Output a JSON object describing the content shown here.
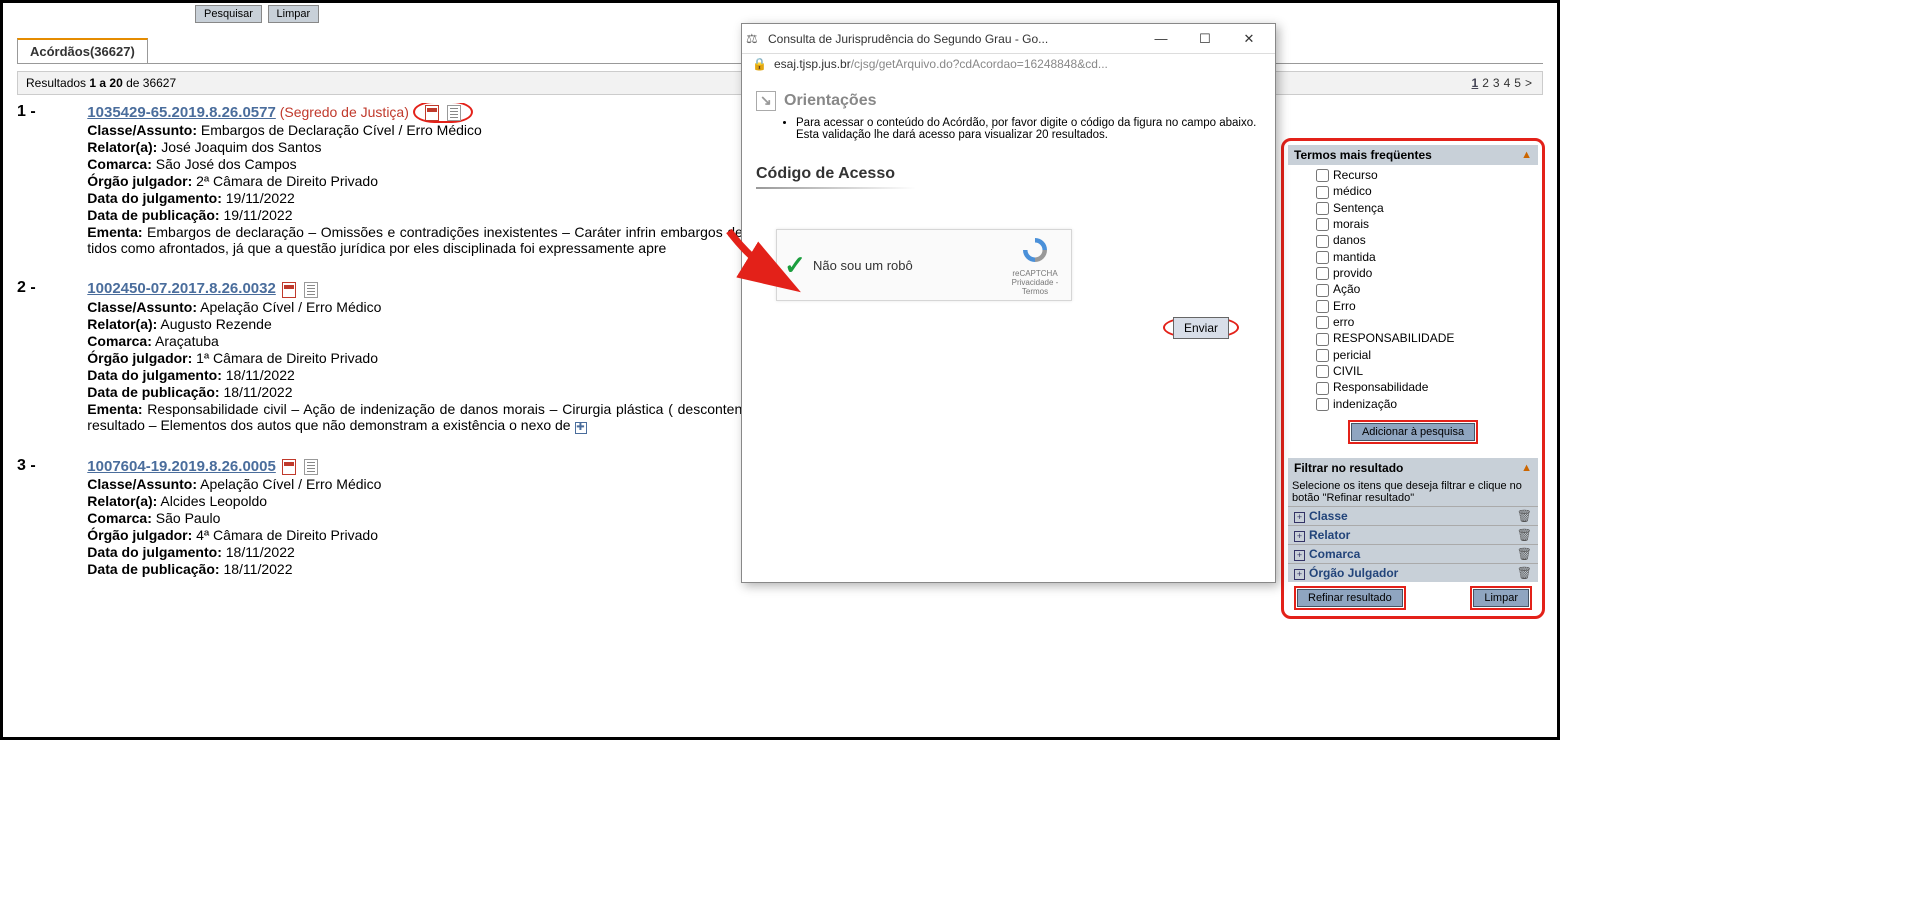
{
  "top_buttons": {
    "pesquisar": "Pesquisar",
    "limpar": "Limpar"
  },
  "tab": {
    "label": "Acórdãos(36627)"
  },
  "results_bar": {
    "prefix": "Resultados ",
    "range_bold": "1 a 20",
    "suffix": " de 36627"
  },
  "pagination": [
    "1",
    "2",
    "3",
    "4",
    "5",
    ">"
  ],
  "results": [
    {
      "num": "1 -",
      "case": "1035429-65.2019.8.26.0577",
      "segredo": "(Segredo de Justiça)",
      "has_segredo": true,
      "circled_icons": true,
      "classe_label": "Classe/Assunto:",
      "classe": " Embargos de Declaração Cível / Erro Médico",
      "relator_label": "Relator(a):",
      "relator": " José Joaquim dos Santos",
      "comarca_label": "Comarca:",
      "comarca": " São José dos Campos",
      "orgao_label": "Órgão julgador:",
      "orgao": " 2ª Câmara de Direito Privado",
      "dj_label": "Data do julgamento:",
      "dj": " 19/11/2022",
      "dp_label": "Data de publicação:",
      "dp": " 19/11/2022",
      "ementa_label": "Ementa:",
      "ementa": " Embargos de declaração – Omissões e contradições inexistentes – Caráter infrin embargos de declaração, que não é a via adequada para tanto – Prequestionamento – Des tidos como afrontados, já que a questão jurídica por eles disciplinada foi expressamente apre",
      "show_expand": false
    },
    {
      "num": "2 -",
      "case": "1002450-07.2017.8.26.0032",
      "has_segredo": false,
      "circled_icons": false,
      "classe_label": "Classe/Assunto:",
      "classe": " Apelação Cível / Erro Médico",
      "relator_label": "Relator(a):",
      "relator": " Augusto Rezende",
      "comarca_label": "Comarca:",
      "comarca": " Araçatuba",
      "orgao_label": "Órgão julgador:",
      "orgao": " 1ª Câmara de Direito Privado",
      "dj_label": "Data do julgamento:",
      "dj": " 18/11/2022",
      "dp_label": "Data de publicação:",
      "dp": " 18/11/2022",
      "ementa_label": "Ementa:",
      "ementa": " Responsabilidade civil – Ação de indenização de danos morais – Cirurgia plástica ( descontentamento com o resultado do procedimento, mas dores no pós-operatório, cefal resultado – Elementos dos autos que não demonstram a existência o nexo de ",
      "show_expand": true
    },
    {
      "num": "3 -",
      "case": "1007604-19.2019.8.26.0005",
      "has_segredo": false,
      "circled_icons": false,
      "classe_label": "Classe/Assunto:",
      "classe": " Apelação Cível / Erro Médico",
      "relator_label": "Relator(a):",
      "relator": " Alcides Leopoldo",
      "comarca_label": "Comarca:",
      "comarca": " São Paulo",
      "orgao_label": "Órgão julgador:",
      "orgao": " 4ª Câmara de Direito Privado",
      "dj_label": "Data do julgamento:",
      "dj": " 18/11/2022",
      "dp_label": "Data de publicação:",
      "dp": " 18/11/2022",
      "ementa_label": "",
      "ementa": "",
      "show_expand": false
    }
  ],
  "side": {
    "terms_header": "Termos mais freqüentes",
    "terms": [
      "Recurso",
      "médico",
      "Sentença",
      "morais",
      "danos",
      "mantida",
      "provido",
      "Ação",
      "Erro",
      "erro",
      "RESPONSABILIDADE",
      "pericial",
      "CIVIL",
      "Responsabilidade",
      "indenização"
    ],
    "add_btn": "Adicionar à pesquisa",
    "filter_header": "Filtrar no resultado",
    "filter_hint": "Selecione os itens que deseja filtrar e clique no botão \"Refinar resultado\"",
    "filters": [
      "Classe",
      "Relator",
      "Comarca",
      "Órgão Julgador"
    ],
    "refine_btn": "Refinar resultado",
    "clear_btn": "Limpar"
  },
  "popup": {
    "title": "Consulta de Jurisprudência do Segundo Grau - Go...",
    "url_secure": "esaj.tjsp.jus.br",
    "url_rest": "/cjsg/getArquivo.do?cdAcordao=16248848&cd...",
    "orient_header": "Orientações",
    "orient_text_1": "Para acessar o conteúdo do Acórdão, por favor digite o código da figura no campo abaixo.",
    "orient_text_2": "Esta validação lhe dará acesso para visualizar 20 resultados.",
    "codigo_header": "Código de Acesso",
    "captcha_text": "Não sou um robô",
    "captcha_brand": "reCAPTCHA",
    "captcha_links": "Privacidade - Termos",
    "enviar": "Enviar"
  }
}
